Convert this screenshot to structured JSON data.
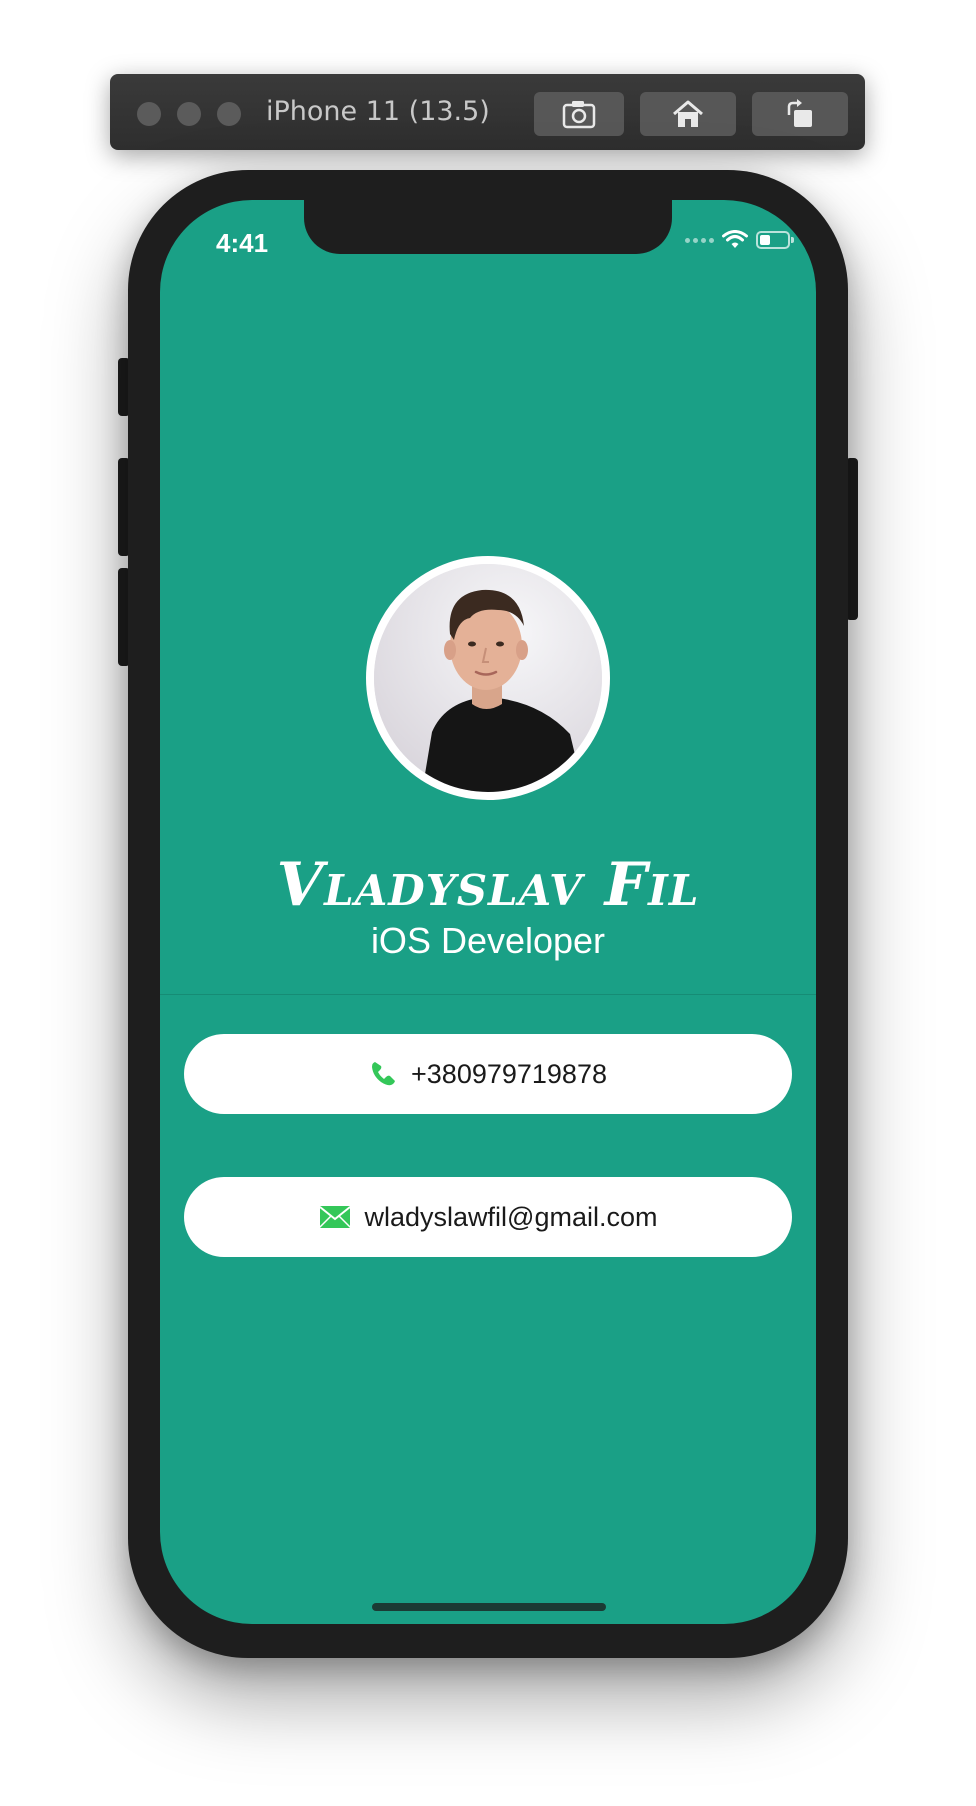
{
  "simulator": {
    "title": "iPhone 11 (13.5)",
    "toolbar_buttons": [
      "camera-icon",
      "home-icon",
      "rotate-icon"
    ]
  },
  "status_bar": {
    "time": "4:41",
    "battery_level": 0.4
  },
  "profile": {
    "name": "Vladyslav Fil",
    "role": "iOS Developer",
    "phone": "+380979719878",
    "email": "wladyslawfil@gmail.com"
  },
  "colors": {
    "background": "#1aa086",
    "card": "#ffffff",
    "icon_green": "#34c759"
  }
}
